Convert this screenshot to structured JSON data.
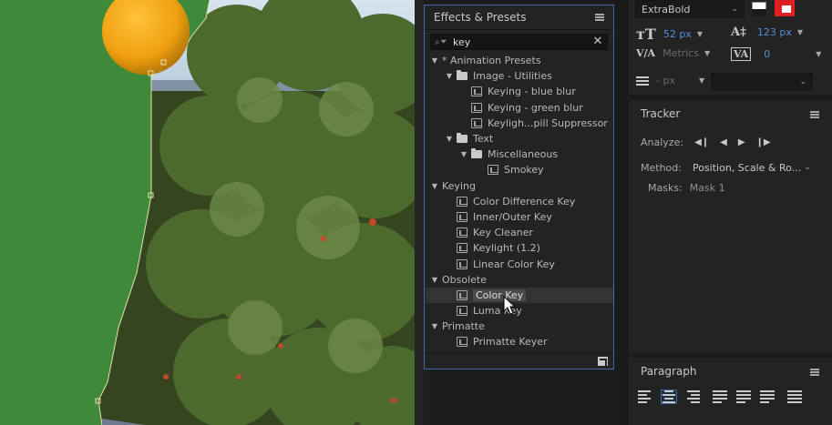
{
  "effects_panel": {
    "title": "Effects & Presets",
    "search": {
      "value": "key",
      "placeholder": ""
    },
    "tree": [
      {
        "label": "* Animation Presets",
        "kind": "category",
        "level": 0,
        "expanded": true
      },
      {
        "label": "Image - Utilities",
        "kind": "folder",
        "level": 1,
        "expanded": true
      },
      {
        "label": "Keying - blue blur",
        "kind": "preset",
        "level": 2
      },
      {
        "label": "Keying - green blur",
        "kind": "preset",
        "level": 2
      },
      {
        "label": "Keyligh...pill Suppressor",
        "kind": "preset",
        "level": 2
      },
      {
        "label": "Text",
        "kind": "folder",
        "level": 1,
        "expanded": true
      },
      {
        "label": "Miscellaneous",
        "kind": "folder",
        "level": 2,
        "expanded": true
      },
      {
        "label": "Smokey",
        "kind": "preset",
        "level": 3
      },
      {
        "label": "Keying",
        "kind": "category",
        "level": 0,
        "expanded": true
      },
      {
        "label": "Color Difference Key",
        "kind": "effect",
        "level": 1
      },
      {
        "label": "Inner/Outer Key",
        "kind": "effect",
        "level": 1
      },
      {
        "label": "Key Cleaner",
        "kind": "effect",
        "level": 1
      },
      {
        "label": "Keylight (1.2)",
        "kind": "effect",
        "level": 1
      },
      {
        "label": "Linear Color Key",
        "kind": "effect",
        "level": 1
      },
      {
        "label": "Obsolete",
        "kind": "category",
        "level": 0,
        "expanded": true
      },
      {
        "label": "Color Key",
        "kind": "effect",
        "level": 1,
        "selected": true
      },
      {
        "label": "Luma Key",
        "kind": "effect",
        "level": 1
      },
      {
        "label": "Primatte",
        "kind": "category",
        "level": 0,
        "expanded": true
      },
      {
        "label": "Primatte Keyer",
        "kind": "effect",
        "level": 1
      }
    ]
  },
  "character": {
    "font_style": "ExtraBold",
    "font_size": "52 px",
    "leading": "123 px",
    "kerning": "Metrics",
    "tracking": "0",
    "stroke_width": "- px",
    "fill_color": "#ffffff",
    "stroke_color": "#e02020"
  },
  "tracker": {
    "title": "Tracker",
    "analyze_label": "Analyze:",
    "method_label": "Method:",
    "method_value": "Position, Scale & Ro...",
    "masks_label": "Masks:",
    "masks_value": "Mask 1"
  },
  "paragraph": {
    "title": "Paragraph",
    "active_alignment_index": 1
  },
  "colors": {
    "accent": "#3d6ea6",
    "matte_green": "#3f8a3a",
    "orange_ball": "#f0a010"
  },
  "icons": [
    "menu-icon",
    "search-icon",
    "clear-icon",
    "folder-icon",
    "effect-icon",
    "new-folder-icon",
    "cursor-icon"
  ]
}
